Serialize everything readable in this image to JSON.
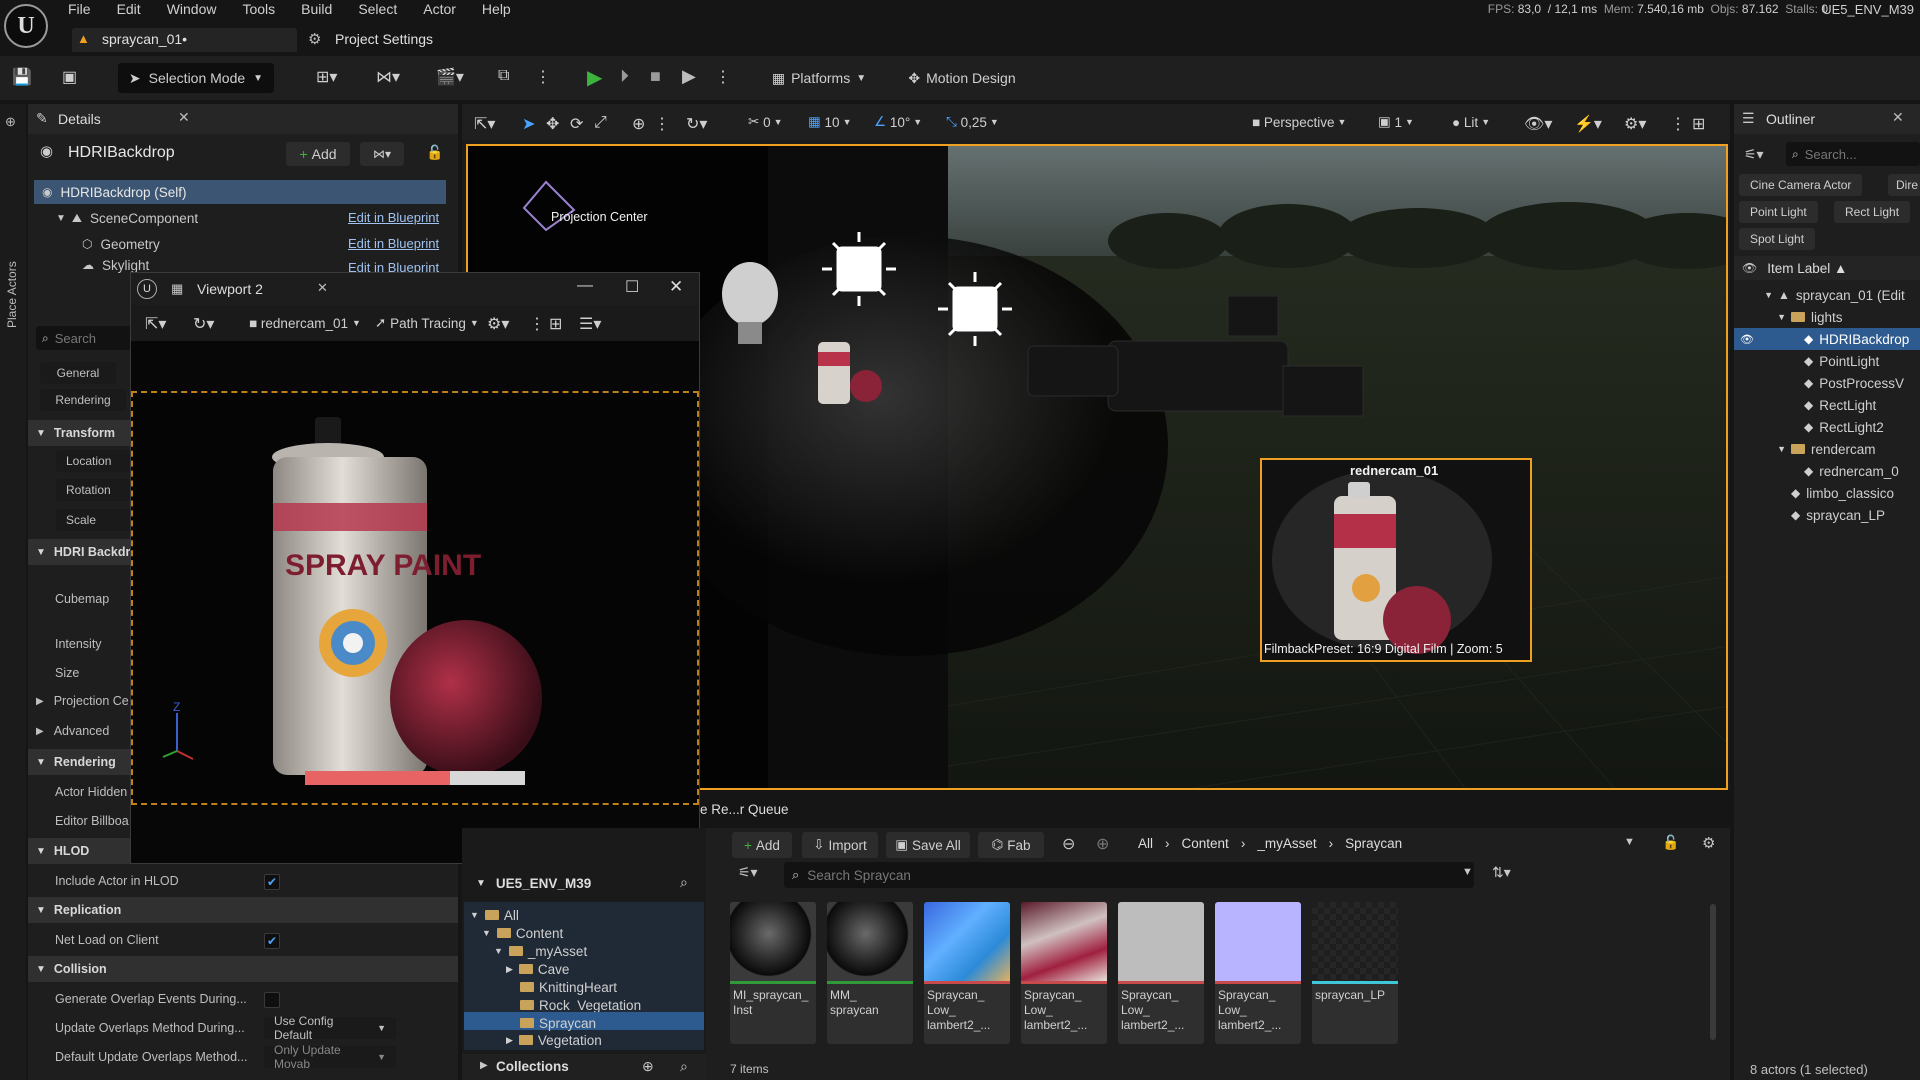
{
  "menu": {
    "items": [
      "File",
      "Edit",
      "Window",
      "Tools",
      "Build",
      "Select",
      "Actor",
      "Help"
    ]
  },
  "stats": {
    "fps_label": "FPS:",
    "fps": "83,0",
    "ms": "/ 12,1 ms",
    "mem_label": "Mem:",
    "mem": "7.540,16 mb",
    "objs_label": "Objs:",
    "objs": "87.162",
    "stalls_label": "Stalls:",
    "stalls": "0"
  },
  "project_name": "UE5_ENV_M39",
  "tabs": {
    "level": "spraycan_01•",
    "settings": "Project Settings"
  },
  "toolbar": {
    "mode": "Selection Mode",
    "platforms": "Platforms",
    "motion_design": "Motion Design"
  },
  "left_strip": {
    "label": "Place Actors"
  },
  "details": {
    "tab_title": "Details",
    "actor_name": "HDRIBackdrop",
    "add_label": "Add",
    "components": [
      {
        "name": "HDRIBackdrop (Self)",
        "link": ""
      },
      {
        "name": "SceneComponent",
        "link": "Edit in Blueprint"
      },
      {
        "name": "Geometry",
        "link": "Edit in Blueprint"
      },
      {
        "name": "Skylight",
        "link": "Edit in Blueprint"
      }
    ],
    "search_placeholder": "Search",
    "filter_general": "General",
    "filter_rendering": "Rendering",
    "transform": "Transform",
    "location": "Location",
    "rotation": "Rotation",
    "scale": "Scale",
    "hdri_section": "HDRI Backdr",
    "cubemap": "Cubemap",
    "intensity": "Intensity",
    "size": "Size",
    "projection": "Projection Ce",
    "advanced": "Advanced",
    "rendering_section": "Rendering",
    "actor_hidden": "Actor Hidden",
    "editor_billboard": "Editor Billboa",
    "hlod_section": "HLOD",
    "include_hlod": "Include Actor in HLOD",
    "replication_section": "Replication",
    "net_load": "Net Load on Client",
    "collision_section": "Collision",
    "gen_overlap": "Generate Overlap Events During...",
    "update_overlap": "Update Overlaps Method During...",
    "update_overlap_val": "Use Config Default",
    "default_update": "Default Update Overlaps Method...",
    "default_update_val": "Only Update Movab"
  },
  "viewport": {
    "perspective": "Perspective",
    "lit": "Lit",
    "grid": "10",
    "angle": "10°",
    "scale": "0,25",
    "snap": "0",
    "cam_speed": "1",
    "projection_center": "Projection Center",
    "pip_camera": "rednercam_01",
    "pip_filmback": "FilmbackPreset: 16:9 Digital Film | Zoom: 5"
  },
  "viewport2": {
    "title": "Viewport 2",
    "camera": "rednercam_01",
    "mode": "Path Tracing",
    "progress": 0.66
  },
  "render_queue": {
    "label": "e Re...r Queue"
  },
  "content_browser": {
    "root": "UE5_ENV_M39",
    "add": "Add",
    "import": "Import",
    "save_all": "Save All",
    "fab": "Fab",
    "path": [
      "All",
      "Content",
      "_myAsset",
      "Spraycan"
    ],
    "search_placeholder": "Search Spraycan",
    "tree": [
      "All",
      "Content",
      "_myAsset",
      "Cave",
      "KnittingHeart",
      "Rock_Vegetation",
      "Spraycan",
      "Vegetation"
    ],
    "collections": "Collections",
    "items_count": "7 items",
    "assets": [
      {
        "name": "MI_spraycan_Inst",
        "line1": "MI_spraycan_",
        "line2": "Inst",
        "line3": "",
        "bar": "#2f9a3a",
        "kind": "sphere"
      },
      {
        "name": "MM_spraycan",
        "line1": "MM_",
        "line2": "spraycan",
        "line3": "",
        "bar": "#2f9a3a",
        "kind": "sphere"
      },
      {
        "name": "Spraycan_Low_lambert2_1",
        "line1": "Spraycan_",
        "line2": "Low_",
        "line3": "lambert2_...",
        "bar": "#c94a4a",
        "kind": "normal"
      },
      {
        "name": "Spraycan_Low_lambert2_2",
        "line1": "Spraycan_",
        "line2": "Low_",
        "line3": "lambert2_...",
        "bar": "#c94a4a",
        "kind": "albedo"
      },
      {
        "name": "Spraycan_Low_lambert2_3",
        "line1": "Spraycan_",
        "line2": "Low_",
        "line3": "lambert2_...",
        "bar": "#c94a4a",
        "kind": "gray"
      },
      {
        "name": "Spraycan_Low_lambert2_4",
        "line1": "Spraycan_",
        "line2": "Low_",
        "line3": "lambert2_...",
        "bar": "#c94a4a",
        "kind": "flat"
      },
      {
        "name": "spraycan_LP",
        "line1": "spraycan_LP",
        "line2": "",
        "line3": "",
        "bar": "#3fc6d8",
        "kind": "mesh"
      }
    ]
  },
  "outliner": {
    "title": "Outliner",
    "search_placeholder": "Search...",
    "chips": [
      "Cine Camera Actor",
      "Dire",
      "Point Light",
      "Rect Light",
      "Spot Light"
    ],
    "column": "Item Label ▲",
    "items": [
      {
        "label": "spraycan_01 (Edit",
        "indent": 1,
        "type": "level"
      },
      {
        "label": "lights",
        "indent": 2,
        "type": "folder"
      },
      {
        "label": "HDRIBackdrop",
        "indent": 3,
        "type": "actor",
        "selected": true
      },
      {
        "label": "PointLight",
        "indent": 3,
        "type": "actor"
      },
      {
        "label": "PostProcessV",
        "indent": 3,
        "type": "actor"
      },
      {
        "label": "RectLight",
        "indent": 3,
        "type": "actor"
      },
      {
        "label": "RectLight2",
        "indent": 3,
        "type": "actor"
      },
      {
        "label": "rendercam",
        "indent": 2,
        "type": "folder"
      },
      {
        "label": "rednercam_0",
        "indent": 3,
        "type": "actor"
      },
      {
        "label": "limbo_classico",
        "indent": 2,
        "type": "actor"
      },
      {
        "label": "spraycan_LP",
        "indent": 2,
        "type": "actor"
      }
    ],
    "footer": "8 actors (1 selected)"
  },
  "colors": {
    "accent": "#f0a020",
    "play": "#3db33d",
    "selection": "#2e5b8f",
    "link": "#9fc2f0"
  }
}
